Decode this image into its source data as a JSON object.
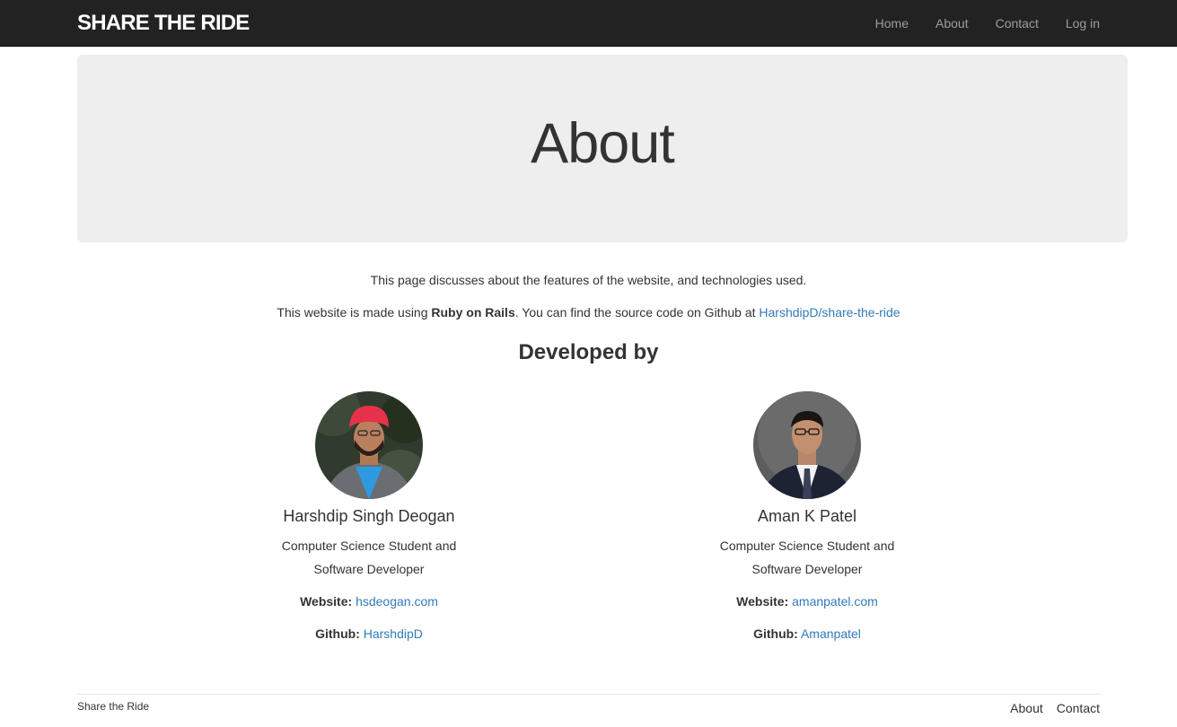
{
  "navbar": {
    "brand": "SHARE THE RIDE",
    "items": [
      "Home",
      "About",
      "Contact",
      "Log in"
    ]
  },
  "jumbotron": {
    "title": "About"
  },
  "intro": {
    "line1": "This page discusses about the features of the website, and technologies used.",
    "line2_prefix": "This website is made using ",
    "line2_bold": "Ruby on Rails",
    "line2_suffix": ". You can find the source code on Github at ",
    "line2_link": "HarshdipD/share-the-ride"
  },
  "developed_by": "Developed by",
  "developers": [
    {
      "name": "Harshdip Singh Deogan",
      "role": "Computer Science Student and Software Developer",
      "website_label": "Website:",
      "website": "hsdeogan.com",
      "github_label": "Github:",
      "github": "HarshdipD"
    },
    {
      "name": "Aman K Patel",
      "role": "Computer Science Student and Software Developer",
      "website_label": "Website:",
      "website": "amanpatel.com",
      "github_label": "Github:",
      "github": "Amanpatel"
    }
  ],
  "footer": {
    "left": "Share the Ride",
    "links": [
      "About",
      "Contact"
    ]
  }
}
